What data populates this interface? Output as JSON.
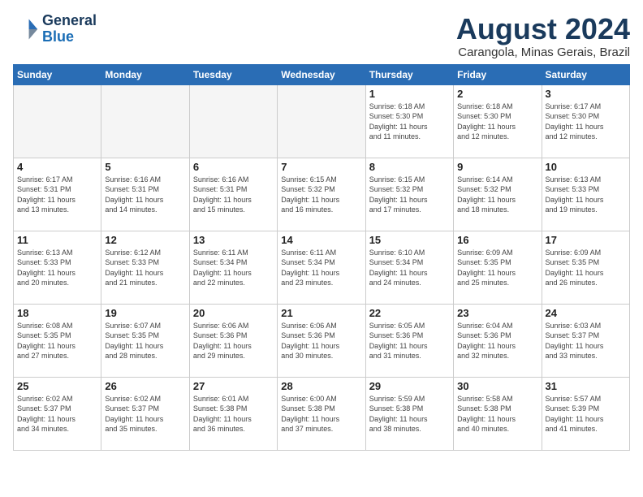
{
  "header": {
    "logo_line1": "General",
    "logo_line2": "Blue",
    "month_title": "August 2024",
    "subtitle": "Carangola, Minas Gerais, Brazil"
  },
  "days_of_week": [
    "Sunday",
    "Monday",
    "Tuesday",
    "Wednesday",
    "Thursday",
    "Friday",
    "Saturday"
  ],
  "weeks": [
    [
      {
        "day": "",
        "info": "",
        "empty": true
      },
      {
        "day": "",
        "info": "",
        "empty": true
      },
      {
        "day": "",
        "info": "",
        "empty": true
      },
      {
        "day": "",
        "info": "",
        "empty": true
      },
      {
        "day": "1",
        "info": "Sunrise: 6:18 AM\nSunset: 5:30 PM\nDaylight: 11 hours\nand 11 minutes."
      },
      {
        "day": "2",
        "info": "Sunrise: 6:18 AM\nSunset: 5:30 PM\nDaylight: 11 hours\nand 12 minutes."
      },
      {
        "day": "3",
        "info": "Sunrise: 6:17 AM\nSunset: 5:30 PM\nDaylight: 11 hours\nand 12 minutes."
      }
    ],
    [
      {
        "day": "4",
        "info": "Sunrise: 6:17 AM\nSunset: 5:31 PM\nDaylight: 11 hours\nand 13 minutes."
      },
      {
        "day": "5",
        "info": "Sunrise: 6:16 AM\nSunset: 5:31 PM\nDaylight: 11 hours\nand 14 minutes."
      },
      {
        "day": "6",
        "info": "Sunrise: 6:16 AM\nSunset: 5:31 PM\nDaylight: 11 hours\nand 15 minutes."
      },
      {
        "day": "7",
        "info": "Sunrise: 6:15 AM\nSunset: 5:32 PM\nDaylight: 11 hours\nand 16 minutes."
      },
      {
        "day": "8",
        "info": "Sunrise: 6:15 AM\nSunset: 5:32 PM\nDaylight: 11 hours\nand 17 minutes."
      },
      {
        "day": "9",
        "info": "Sunrise: 6:14 AM\nSunset: 5:32 PM\nDaylight: 11 hours\nand 18 minutes."
      },
      {
        "day": "10",
        "info": "Sunrise: 6:13 AM\nSunset: 5:33 PM\nDaylight: 11 hours\nand 19 minutes."
      }
    ],
    [
      {
        "day": "11",
        "info": "Sunrise: 6:13 AM\nSunset: 5:33 PM\nDaylight: 11 hours\nand 20 minutes."
      },
      {
        "day": "12",
        "info": "Sunrise: 6:12 AM\nSunset: 5:33 PM\nDaylight: 11 hours\nand 21 minutes."
      },
      {
        "day": "13",
        "info": "Sunrise: 6:11 AM\nSunset: 5:34 PM\nDaylight: 11 hours\nand 22 minutes."
      },
      {
        "day": "14",
        "info": "Sunrise: 6:11 AM\nSunset: 5:34 PM\nDaylight: 11 hours\nand 23 minutes."
      },
      {
        "day": "15",
        "info": "Sunrise: 6:10 AM\nSunset: 5:34 PM\nDaylight: 11 hours\nand 24 minutes."
      },
      {
        "day": "16",
        "info": "Sunrise: 6:09 AM\nSunset: 5:35 PM\nDaylight: 11 hours\nand 25 minutes."
      },
      {
        "day": "17",
        "info": "Sunrise: 6:09 AM\nSunset: 5:35 PM\nDaylight: 11 hours\nand 26 minutes."
      }
    ],
    [
      {
        "day": "18",
        "info": "Sunrise: 6:08 AM\nSunset: 5:35 PM\nDaylight: 11 hours\nand 27 minutes."
      },
      {
        "day": "19",
        "info": "Sunrise: 6:07 AM\nSunset: 5:35 PM\nDaylight: 11 hours\nand 28 minutes."
      },
      {
        "day": "20",
        "info": "Sunrise: 6:06 AM\nSunset: 5:36 PM\nDaylight: 11 hours\nand 29 minutes."
      },
      {
        "day": "21",
        "info": "Sunrise: 6:06 AM\nSunset: 5:36 PM\nDaylight: 11 hours\nand 30 minutes."
      },
      {
        "day": "22",
        "info": "Sunrise: 6:05 AM\nSunset: 5:36 PM\nDaylight: 11 hours\nand 31 minutes."
      },
      {
        "day": "23",
        "info": "Sunrise: 6:04 AM\nSunset: 5:36 PM\nDaylight: 11 hours\nand 32 minutes."
      },
      {
        "day": "24",
        "info": "Sunrise: 6:03 AM\nSunset: 5:37 PM\nDaylight: 11 hours\nand 33 minutes."
      }
    ],
    [
      {
        "day": "25",
        "info": "Sunrise: 6:02 AM\nSunset: 5:37 PM\nDaylight: 11 hours\nand 34 minutes."
      },
      {
        "day": "26",
        "info": "Sunrise: 6:02 AM\nSunset: 5:37 PM\nDaylight: 11 hours\nand 35 minutes."
      },
      {
        "day": "27",
        "info": "Sunrise: 6:01 AM\nSunset: 5:38 PM\nDaylight: 11 hours\nand 36 minutes."
      },
      {
        "day": "28",
        "info": "Sunrise: 6:00 AM\nSunset: 5:38 PM\nDaylight: 11 hours\nand 37 minutes."
      },
      {
        "day": "29",
        "info": "Sunrise: 5:59 AM\nSunset: 5:38 PM\nDaylight: 11 hours\nand 38 minutes."
      },
      {
        "day": "30",
        "info": "Sunrise: 5:58 AM\nSunset: 5:38 PM\nDaylight: 11 hours\nand 40 minutes."
      },
      {
        "day": "31",
        "info": "Sunrise: 5:57 AM\nSunset: 5:39 PM\nDaylight: 11 hours\nand 41 minutes."
      }
    ]
  ]
}
